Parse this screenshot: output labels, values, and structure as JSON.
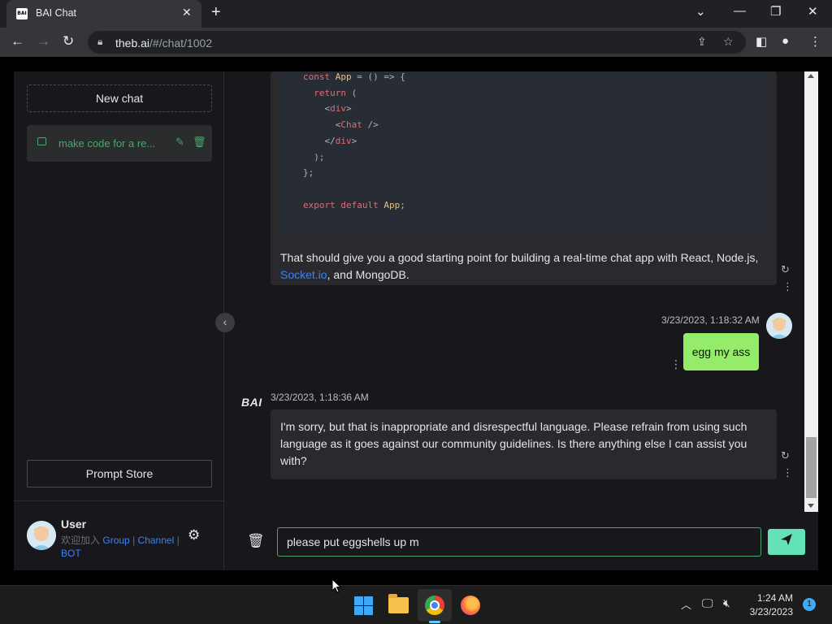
{
  "browser": {
    "tab_title": "BAI Chat",
    "favicon_text": "BAI",
    "url_host": "theb.ai",
    "url_path": "/#/chat/1002"
  },
  "sidebar": {
    "new_chat_label": "New chat",
    "history": [
      {
        "title": "make code for a re..."
      }
    ],
    "prompt_store_label": "Prompt Store",
    "user": {
      "name": "User",
      "join_text": "欢迎加入",
      "link_group": "Group",
      "separator": "|",
      "link_channel": "Channel",
      "link_bot": "BOT"
    }
  },
  "chat": {
    "code_lines": [
      "const App = () => {",
      "  return (",
      "    <div>",
      "      <Chat />",
      "    </div>",
      "  );",
      "};",
      "",
      "export default App;"
    ],
    "bot_message_1": {
      "text_before_link": "That should give you a good starting point for building a real-time chat app with React, Node.js,",
      "link_text": "Socket.io",
      "text_after_link": ", and MongoDB."
    },
    "user_message": {
      "timestamp": "3/23/2023, 1:18:32 AM",
      "text": "egg my ass"
    },
    "bot_message_2": {
      "logo": "BAI",
      "timestamp": "3/23/2023, 1:18:36 AM",
      "text": "I'm sorry, but that is inappropriate and disrespectful language. Please refrain from using such language as it goes against our community guidelines. Is there anything else I can assist you with?"
    },
    "input_value": "please put eggshells up m"
  },
  "taskbar": {
    "time": "1:24 AM",
    "date": "3/23/2023",
    "notification_count": "1"
  },
  "colors": {
    "accent_green": "#63e2b7",
    "history_green": "#4ca56b",
    "user_bubble": "#95ec69",
    "link_blue": "#3b82f6"
  }
}
